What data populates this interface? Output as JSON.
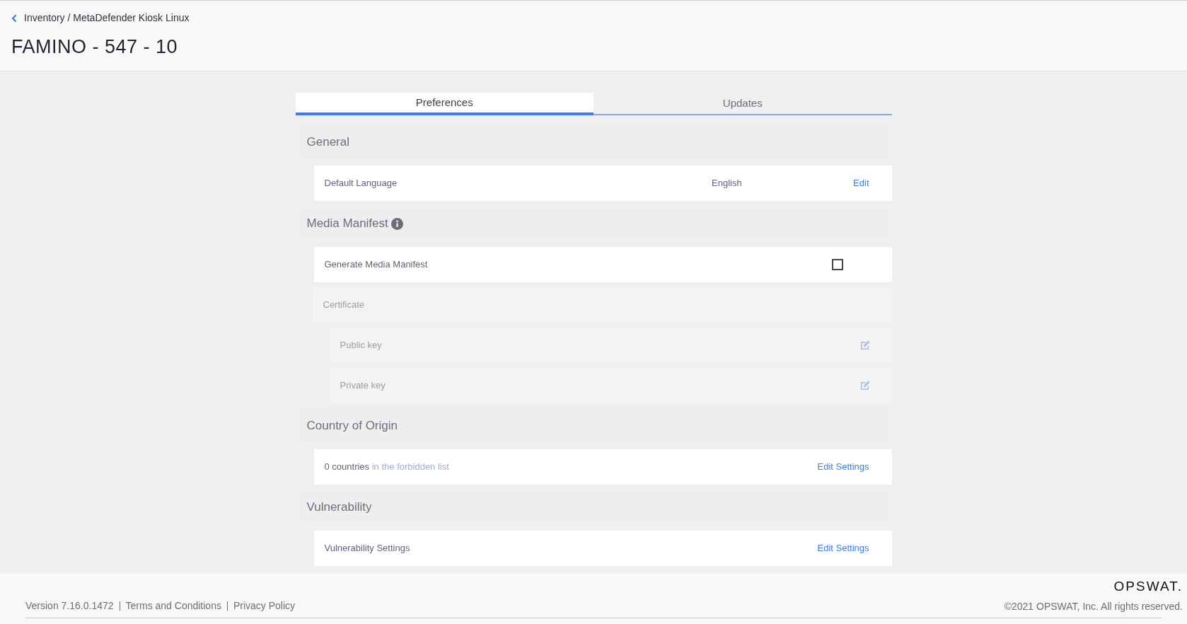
{
  "breadcrumb": "Inventory / MetaDefender Kiosk Linux",
  "title": "FAMINO - 547 - 10",
  "tabs": [
    {
      "label": "Preferences",
      "selected": true
    },
    {
      "label": "Updates",
      "selected": false
    }
  ],
  "sections": [
    {
      "title": "General",
      "info_icon": false,
      "rows": [
        {
          "kind": "value",
          "label": "Default Language",
          "value": "English",
          "action": "Edit"
        }
      ]
    },
    {
      "title": "Media Manifest",
      "info_icon": true,
      "rows": [
        {
          "kind": "checkbox",
          "label": "Generate Media Manifest",
          "checked": false,
          "children": [
            {
              "kind": "group",
              "label": "Certificate",
              "disabled": true,
              "children": [
                {
                  "kind": "editable",
                  "label": "Public key",
                  "disabled": true
                },
                {
                  "kind": "editable",
                  "label": "Private key",
                  "disabled": true
                }
              ]
            }
          ]
        }
      ]
    },
    {
      "title": "Country of Origin",
      "info_icon": false,
      "rows": [
        {
          "kind": "count",
          "count": "0 countries",
          "note": "in the forbidden list",
          "action": "Edit Settings"
        }
      ]
    },
    {
      "title": "Vulnerability",
      "info_icon": false,
      "rows": [
        {
          "kind": "value",
          "label": "Vulnerability Settings",
          "action": "Edit Settings"
        }
      ]
    }
  ],
  "footer": {
    "version": "Version 7.16.0.1472",
    "links": [
      "Terms and Conditions",
      "Privacy Policy"
    ],
    "logo": "OPSWAT.",
    "copyright": "©2021 OPSWAT, Inc. All rights reserved."
  }
}
